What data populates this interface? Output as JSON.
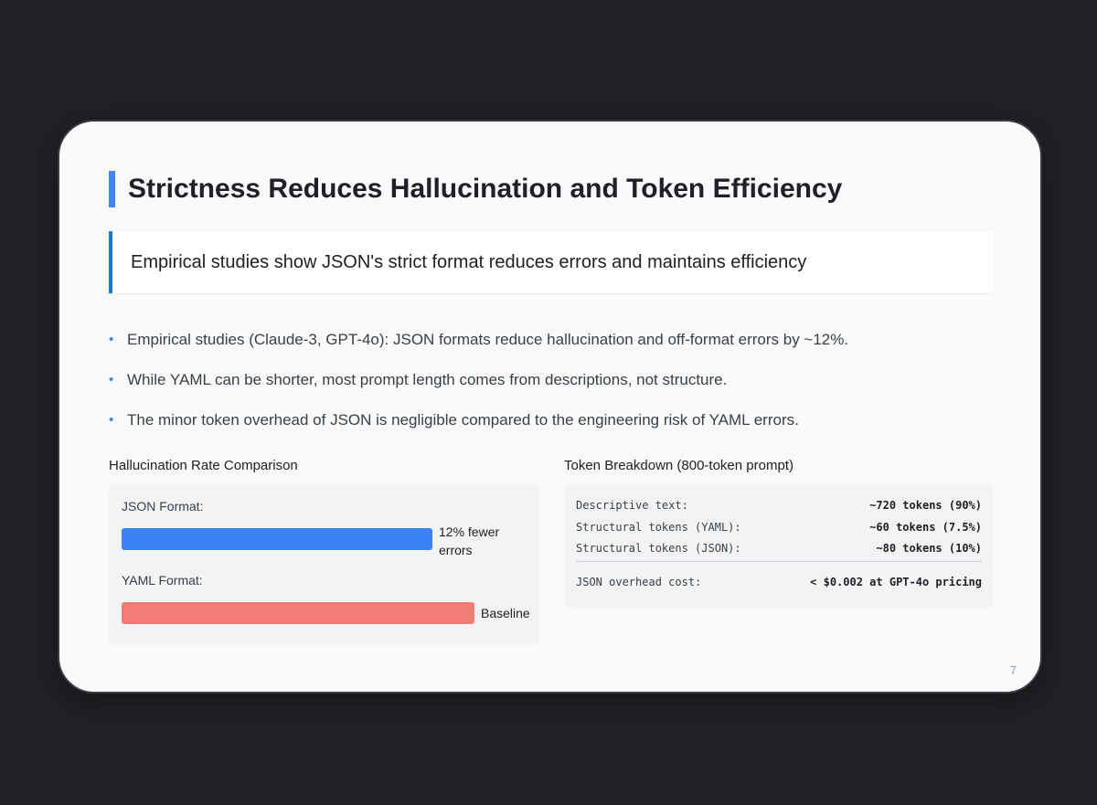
{
  "slide": {
    "title": "Strictness Reduces Hallucination and Token Efficiency",
    "callout": "Empirical studies show JSON's strict format reduces errors and maintains efficiency",
    "bullets": [
      "Empirical studies (Claude-3, GPT-4o): JSON formats reduce hallucination and off-format errors by ~12%.",
      "While YAML can be shorter, most prompt length comes from descriptions, not structure.",
      "The minor token overhead of JSON is negligible compared to the engineering risk of YAML errors."
    ],
    "page_number": "7"
  },
  "hallucination_chart": {
    "title": "Hallucination Rate Comparison",
    "bars": [
      {
        "label": "JSON Format:",
        "value": 88,
        "note": "12% fewer errors",
        "color": "#3b82f6"
      },
      {
        "label": "YAML Format:",
        "value": 100,
        "note": "Baseline",
        "color": "#f47a76"
      }
    ]
  },
  "chart_data": {
    "type": "bar",
    "categories": [
      "JSON Format:",
      "YAML Format:"
    ],
    "values": [
      88,
      100
    ],
    "title": "Hallucination Rate Comparison",
    "xlabel": "",
    "ylabel": "",
    "ylim": [
      0,
      100
    ]
  },
  "token_breakdown": {
    "title": "Token Breakdown (800-token prompt)",
    "rows": [
      {
        "label": "Descriptive text:",
        "value": "~720 tokens (90%)"
      },
      {
        "label": "Structural tokens (YAML):",
        "value": "~60 tokens (7.5%)"
      },
      {
        "label": "Structural tokens (JSON):",
        "value": "~80 tokens (10%)"
      }
    ],
    "overhead": {
      "label": "JSON overhead cost:",
      "value": "< $0.002 at GPT-4o pricing"
    }
  },
  "colors": {
    "accent": "#4285f4",
    "callout_border": "#1a73e8",
    "json_bar": "#3b82f6",
    "yaml_bar": "#f47a76"
  }
}
